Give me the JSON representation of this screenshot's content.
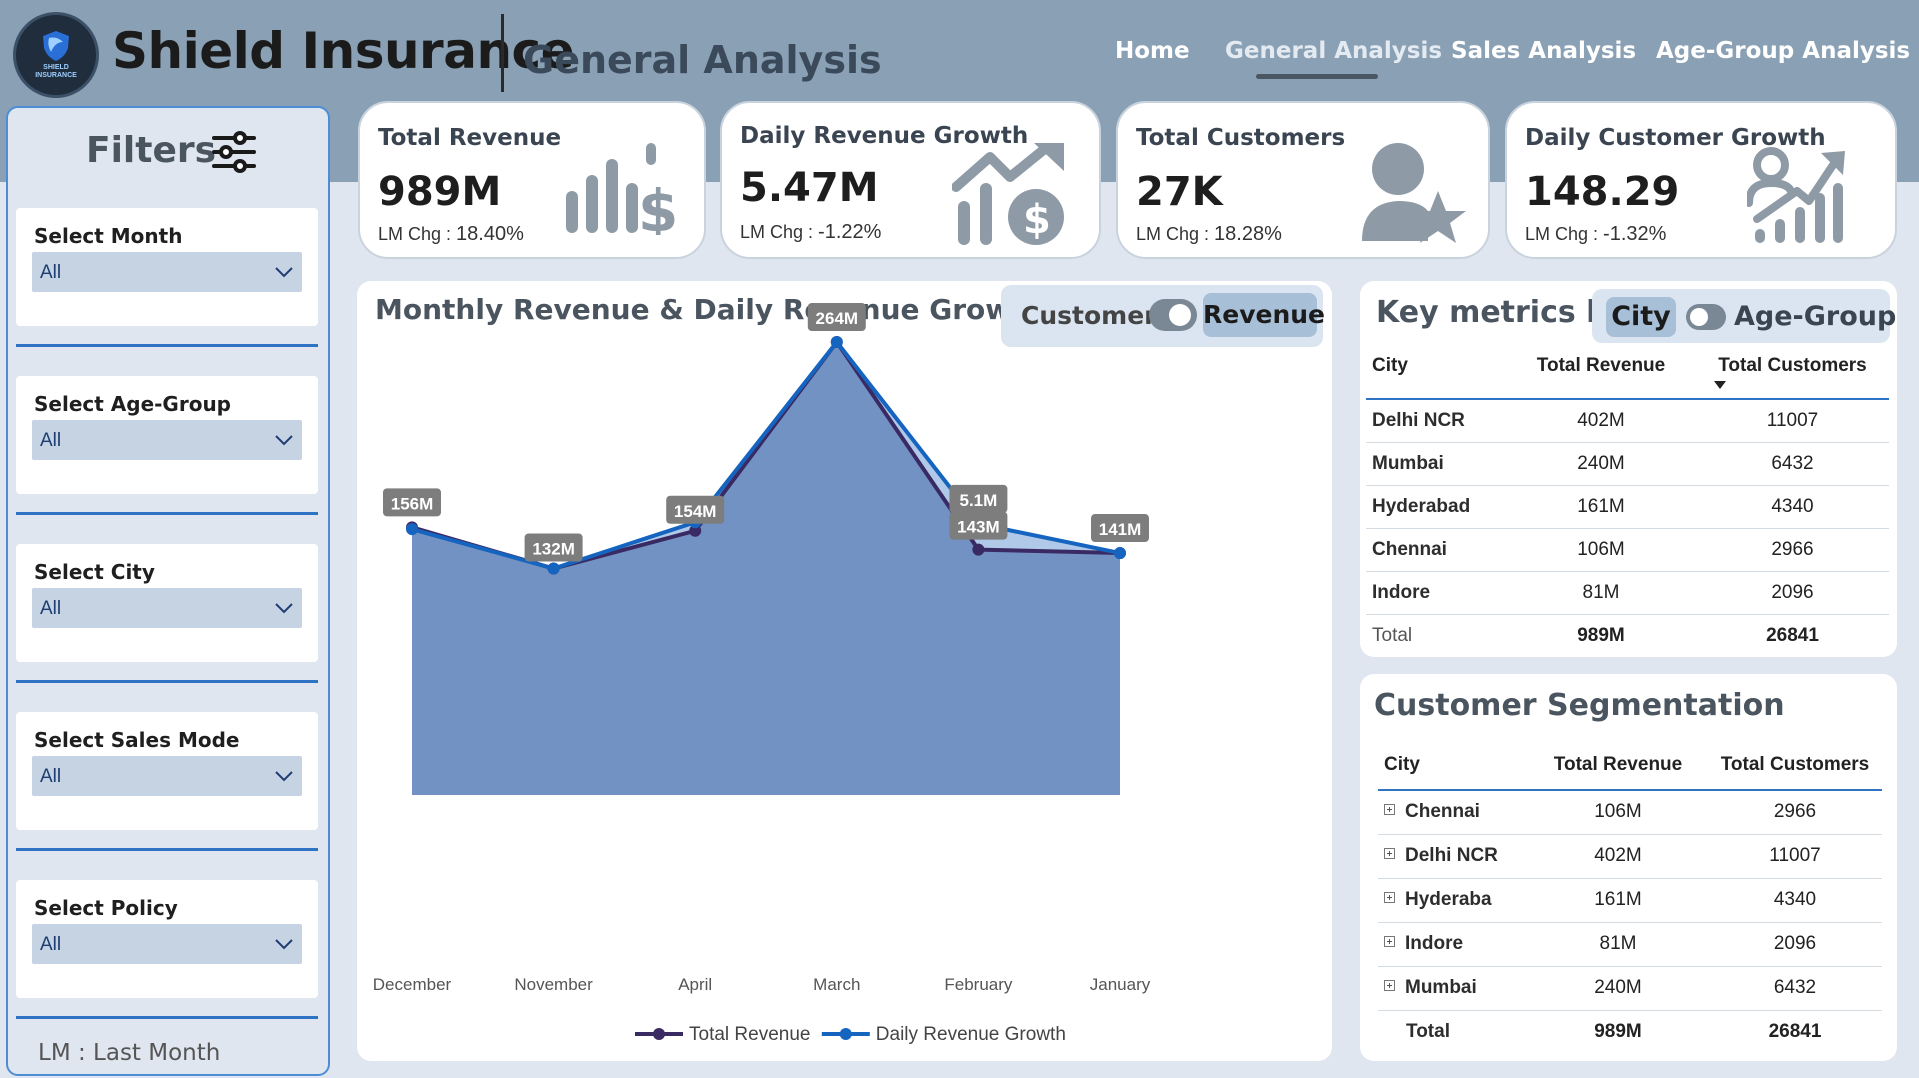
{
  "header": {
    "logo_text_line1": "SHIELD",
    "logo_text_line2": "INSURANCE",
    "brand": "Shield Insurance",
    "page_title": "General Analysis",
    "nav": [
      "Home",
      "General Analysis",
      "Sales Analysis",
      "Age-Group Analysis"
    ],
    "active_nav": "General Analysis"
  },
  "filters": {
    "title": "Filters",
    "items": [
      {
        "label": "Select Month",
        "value": "All"
      },
      {
        "label": "Select Age-Group",
        "value": "All"
      },
      {
        "label": "Select City",
        "value": "All"
      },
      {
        "label": "Select Sales Mode",
        "value": "All"
      },
      {
        "label": "Select Policy",
        "value": "All"
      }
    ],
    "note": "LM : Last Month"
  },
  "kpis": [
    {
      "title": "Total Revenue",
      "value": "989M",
      "chg_prefix": "LM Chg : ",
      "chg": "18.40%",
      "icon": "bar-chart-dollar-icon"
    },
    {
      "title": "Daily Revenue Growth",
      "value": "5.47M",
      "chg_prefix": "LM Chg : ",
      "chg": "-1.22%",
      "icon": "growth-dollar-icon"
    },
    {
      "title": "Total Customers",
      "value": "27K",
      "chg_prefix": "LM Chg : ",
      "chg": "18.28%",
      "icon": "user-star-icon"
    },
    {
      "title": "Daily Customer Growth",
      "value": "148.29",
      "chg_prefix": "LM Chg : ",
      "chg": "-1.32%",
      "icon": "user-growth-icon"
    }
  ],
  "chart": {
    "title": "Monthly Revenue & Daily Revenue Growth",
    "toggle_left": "Customer",
    "toggle_right": "Revenue"
  },
  "chart_data": {
    "type": "area",
    "categories": [
      "December",
      "November",
      "April",
      "March",
      "February",
      "January"
    ],
    "series": [
      {
        "name": "Total Revenue",
        "values": [
          156,
          132,
          154,
          264,
          143,
          141
        ],
        "labels": [
          "156M",
          "132M",
          "154M",
          "264M",
          "143M",
          "141M"
        ],
        "color": "#3a2a63"
      },
      {
        "name": "Daily Revenue Growth",
        "values": [
          5.0,
          4.26,
          5.13,
          8.52,
          5.1,
          4.55
        ],
        "labels": [
          "",
          "",
          "",
          "",
          "5.1M",
          ""
        ],
        "color": "#1565c0"
      }
    ],
    "legend_position": "bottom",
    "grid": false
  },
  "key_metrics": {
    "title": "Key metrics by",
    "toggle_left": "City",
    "toggle_right": "Age-Group",
    "columns": [
      "City",
      "Total Revenue",
      "Total Customers"
    ],
    "rows": [
      [
        "Delhi NCR",
        "402M",
        "11007"
      ],
      [
        "Mumbai",
        "240M",
        "6432"
      ],
      [
        "Hyderabad",
        "161M",
        "4340"
      ],
      [
        "Chennai",
        "106M",
        "2966"
      ],
      [
        "Indore",
        "81M",
        "2096"
      ]
    ],
    "total": [
      "Total",
      "989M",
      "26841"
    ]
  },
  "segmentation": {
    "title": "Customer Segmentation",
    "columns": [
      "City",
      "Total Revenue",
      "Total Customers"
    ],
    "rows": [
      [
        "Chennai",
        "106M",
        "2966"
      ],
      [
        "Delhi NCR",
        "402M",
        "11007"
      ],
      [
        "Hyderaba",
        "161M",
        "4340"
      ],
      [
        "Indore",
        "81M",
        "2096"
      ],
      [
        "Mumbai",
        "240M",
        "6432"
      ]
    ],
    "total": [
      "Total",
      "989M",
      "26841"
    ]
  },
  "colors": {
    "header_bg": "#8aa0b4",
    "page_bg": "#dfe6ef",
    "accent_blue": "#2f73c4",
    "area_fill": "#6f8fc2",
    "revenue_line": "#3a2a63",
    "growth_line": "#1565c0"
  }
}
